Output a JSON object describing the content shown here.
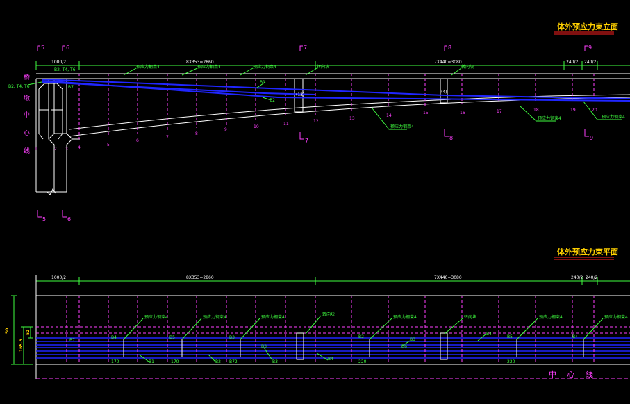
{
  "titles": {
    "elevation": "体外预应力束立面",
    "plan": "体外预应力束平面"
  },
  "section_marks": [
    "5",
    "6",
    "7",
    "8",
    "9",
    "5",
    "6",
    "7",
    "8",
    "9"
  ],
  "section_labels": {
    "s5_top": "5",
    "s6_top": "6",
    "s7_top": "7",
    "s8_top": "8",
    "s9_top": "9",
    "s5_bot": "5",
    "s6_bot": "6",
    "s7_bot": "7",
    "s8_bot": "8",
    "s9_bot": "9"
  },
  "elev_dims": {
    "d1": "1000/2",
    "d2": "8X353=2860",
    "d3": "7X440=3080",
    "d4": "240/2",
    "d5": "240/2"
  },
  "plan_dims": {
    "d1": "1000/2",
    "d2": "8X353=2860",
    "d3": "7X440=3080",
    "d4": "240/2",
    "d5": "240/2"
  },
  "bridge_center": [
    "桥",
    "墩",
    "中",
    "心",
    "线"
  ],
  "elev_left": {
    "b1": "B2, T4, T6",
    "b2": "B2, T4, T6",
    "b3": "B7"
  },
  "node_numbers": [
    "1",
    "2",
    "3",
    "4",
    "5",
    "6",
    "7",
    "8",
    "9",
    "10",
    "11",
    "12",
    "13",
    "14",
    "15",
    "16",
    "17",
    "18",
    "19",
    "20"
  ],
  "elev_notes": {
    "n1": "预应力钢束4",
    "n2": "预应力钢束4",
    "n3": "预应力钢束4",
    "n4": "转向块",
    "n5": "转向块",
    "n6": "预应力钢束4",
    "n7": "预应力钢束4",
    "n8": "预应力钢束4",
    "a1": "B1",
    "a2": "B2",
    "bx1": "(13)",
    "bx2": "(4)"
  },
  "plan_notes": {
    "n1": "预应力钢束4",
    "n2": "预应力钢束4",
    "n3": "预应力钢束4",
    "n4": "转向块",
    "n5": "预应力钢束4",
    "n6": "转向块",
    "n7": "预应力钢束4",
    "n8": "预应力钢束4"
  },
  "plan_labels": {
    "w1": "B7",
    "w2": "B4",
    "w3": "B5",
    "w4": "B3",
    "w5": "B3",
    "w6": "B2",
    "w7": "B3",
    "w8": "B4",
    "w9": "B5",
    "w10": "B4",
    "v1": "170",
    "v2": "B1",
    "v3": "170",
    "v4": "B2",
    "v5": "B72",
    "v6": "B3",
    "v7": "B4",
    "v8": "220",
    "v9": "B6",
    "v10": "220",
    "left1": "50",
    "left2": "165.5",
    "left3": "52"
  },
  "center_line": "中 心 线",
  "colors": {
    "cyan": "#00ffff",
    "magenta": "#ff40ff",
    "green": "#40ff40",
    "blue": "#1e20ff",
    "yellow": "#ffd000",
    "red": "#ff2020",
    "white": "#ffffff"
  }
}
